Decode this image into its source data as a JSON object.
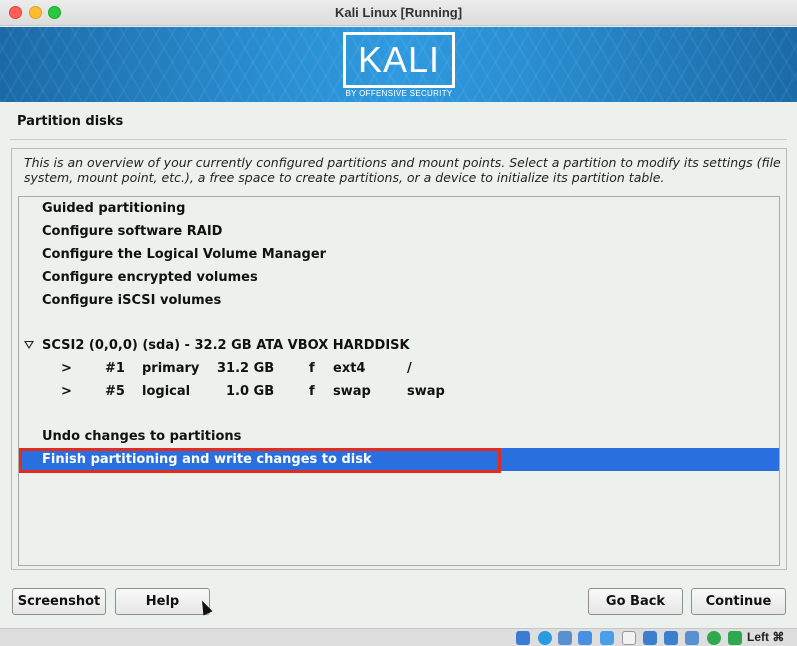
{
  "window": {
    "title": "Kali Linux [Running]"
  },
  "banner": {
    "logo_text": "KALI",
    "logo_subtitle": "BY OFFENSIVE SECURITY"
  },
  "installer": {
    "section_title": "Partition disks",
    "description": "This is an overview of your currently configured partitions and mount points. Select a partition to modify its settings (file system, mount point, etc.), a free space to create partitions, or a device to initialize its partition table.",
    "options": {
      "guided": "Guided partitioning",
      "raid": "Configure software RAID",
      "lvm": "Configure the Logical Volume Manager",
      "encrypted": "Configure encrypted volumes",
      "iscsi": "Configure iSCSI volumes"
    },
    "disk": {
      "label": "SCSI2 (0,0,0) (sda) - 32.2 GB ATA VBOX HARDDISK",
      "partitions": [
        {
          "arrow": ">",
          "num": "#1",
          "type": "primary",
          "size": "31.2 GB",
          "flag": "f",
          "fs": "ext4",
          "mount": "/"
        },
        {
          "arrow": ">",
          "num": "#5",
          "type": "logical",
          "size": "1.0 GB",
          "flag": "f",
          "fs": "swap",
          "mount": "swap"
        }
      ]
    },
    "undo": "Undo changes to partitions",
    "finish": "Finish partitioning and write changes to disk"
  },
  "buttons": {
    "screenshot": "Screenshot",
    "help": "Help",
    "go_back": "Go Back",
    "continue": "Continue"
  },
  "statusbar": {
    "host_key": "Left ⌘"
  },
  "colors": {
    "selection": "#2a6fe0",
    "highlight_border": "#e32b1e",
    "banner": "#2a8fd2"
  }
}
